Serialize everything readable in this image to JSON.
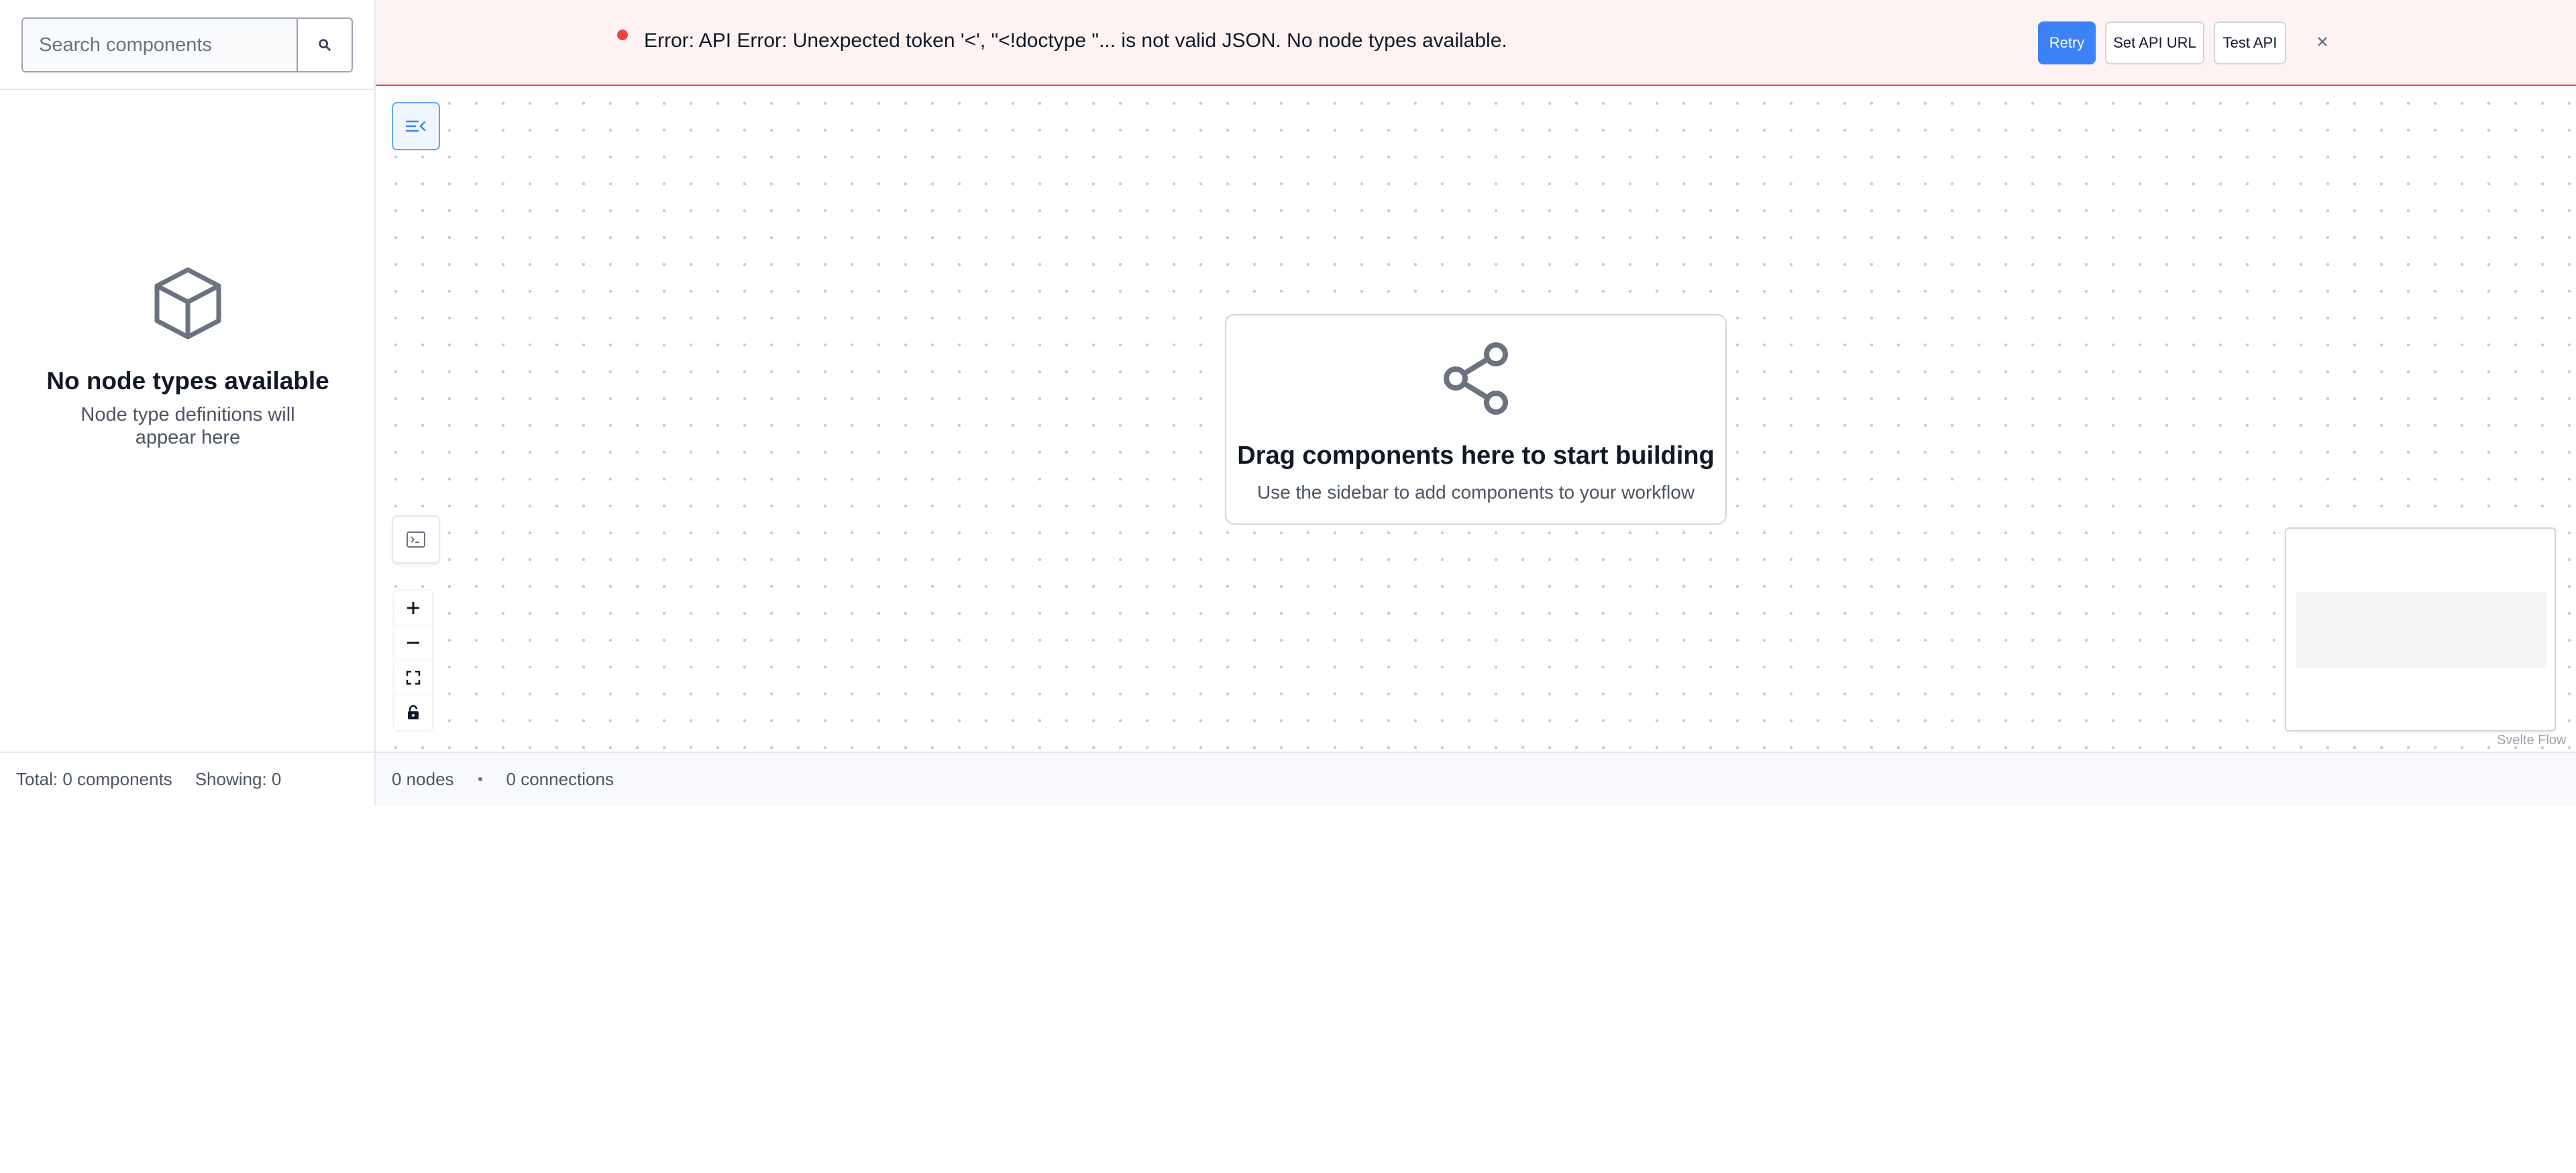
{
  "sidebar": {
    "search": {
      "placeholder": "Search components"
    },
    "empty_state": {
      "title": "No node types available",
      "subtitle": "Node type definitions will appear here"
    },
    "footer": {
      "total": "Total: 0 components",
      "showing": "Showing: 0"
    }
  },
  "error_banner": {
    "message": "Error: API Error: Unexpected token '<', \"<!doctype \"... is not valid JSON. No node types available.",
    "retry_label": "Retry",
    "set_api_url_label": "Set API URL",
    "test_api_label": "Test API",
    "close_label": "×",
    "status_color": "#ef4444"
  },
  "canvas": {
    "drop_card": {
      "title": "Drag components here to start building",
      "subtitle": "Use the sidebar to add components to your workflow",
      "icon": "share-icon"
    },
    "attribution": "Svelte Flow"
  },
  "statusbar": {
    "nodes": "0 nodes",
    "connections": "0 connections"
  },
  "colors": {
    "accent": "#3b82f6",
    "error": "#ef4444",
    "error_bg": "#fef2f2"
  }
}
